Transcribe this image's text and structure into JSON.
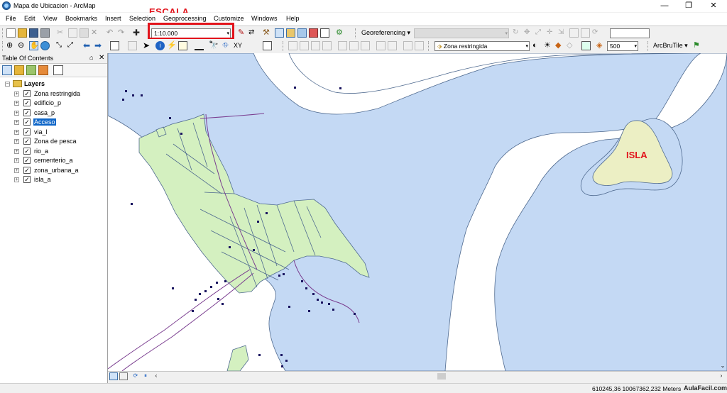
{
  "window": {
    "title": "Mapa de Ubicacion - ArcMap",
    "minimize": "—",
    "maximize": "❐",
    "close": "✕"
  },
  "menu": [
    "File",
    "Edit",
    "View",
    "Bookmarks",
    "Insert",
    "Selection",
    "Geoprocessing",
    "Customize",
    "Windows",
    "Help"
  ],
  "toolbar": {
    "scale_value": "1:10.000",
    "scale_annotation": "ESCALA",
    "georeferencing_label": "Georeferencing ▾",
    "target_layer": "Zona restringida",
    "opacity_value": "500",
    "arcbrutile_label": "ArcBruTile ▾"
  },
  "toc": {
    "title": "Table Of Contents",
    "pin": "⌂",
    "close": "✕",
    "group": "Layers",
    "layers": [
      {
        "name": "Zona restringida",
        "checked": true,
        "selected": false
      },
      {
        "name": "edificio_p",
        "checked": true,
        "selected": false
      },
      {
        "name": "casa_p",
        "checked": true,
        "selected": false
      },
      {
        "name": "Acceso",
        "checked": true,
        "selected": true
      },
      {
        "name": "via_l",
        "checked": true,
        "selected": false
      },
      {
        "name": "Zona de pesca",
        "checked": true,
        "selected": false
      },
      {
        "name": "rio_a",
        "checked": true,
        "selected": false
      },
      {
        "name": "cementerio_a",
        "checked": true,
        "selected": false
      },
      {
        "name": "zona_urbana_a",
        "checked": true,
        "selected": false
      },
      {
        "name": "isla_a",
        "checked": true,
        "selected": false
      }
    ]
  },
  "map": {
    "island_label": "ISLA",
    "colors": {
      "water": "#c4d9f4",
      "urban": "#d4f0c0",
      "island": "#ecefc4",
      "road": "#7a3d8f",
      "point": "#1a1560"
    }
  },
  "status": {
    "coordinates": "610245,36  10067362,232 Meters",
    "watermark": "AulaFacil.com"
  }
}
